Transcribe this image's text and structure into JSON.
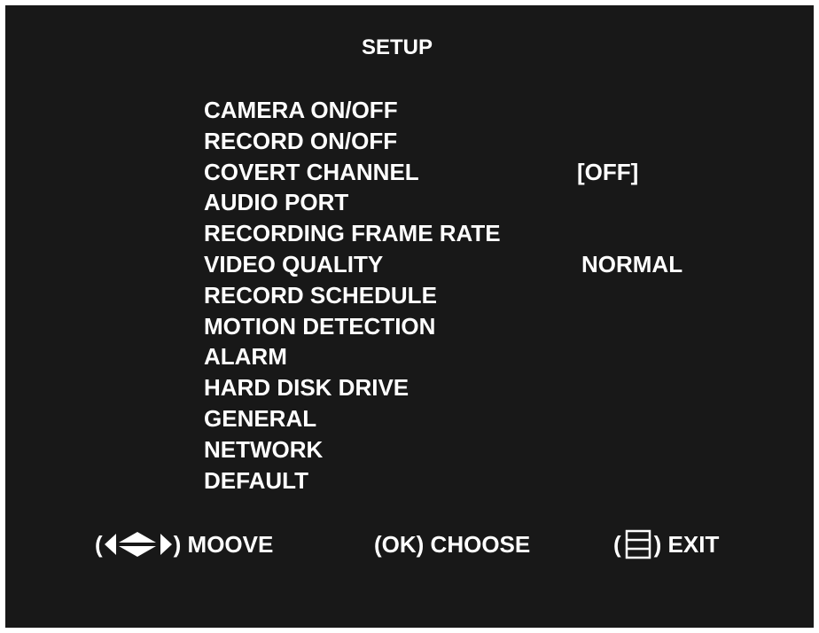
{
  "title": "SETUP",
  "menu": {
    "items": [
      {
        "label": "CAMERA ON/OFF",
        "value": ""
      },
      {
        "label": "RECORD ON/OFF",
        "value": ""
      },
      {
        "label": "COVERT CHANNEL",
        "value": "[OFF]"
      },
      {
        "label": "AUDIO PORT",
        "value": ""
      },
      {
        "label": "RECORDING FRAME RATE",
        "value": ""
      },
      {
        "label": "VIDEO QUALITY",
        "value": "NORMAL"
      },
      {
        "label": "RECORD SCHEDULE",
        "value": ""
      },
      {
        "label": "MOTION DETECTION",
        "value": ""
      },
      {
        "label": "ALARM",
        "value": ""
      },
      {
        "label": "HARD DISK DRIVE",
        "value": ""
      },
      {
        "label": "GENERAL",
        "value": ""
      },
      {
        "label": "NETWORK",
        "value": ""
      },
      {
        "label": "DEFAULT",
        "value": ""
      }
    ]
  },
  "footer": {
    "open_paren": "(",
    "close_paren_move": ") MOOVE",
    "choose": "(OK) CHOOSE",
    "exit_open": "(",
    "exit_close": ") EXIT",
    "move_icon": "arrow-keys-icon",
    "exit_icon": "menu-icon"
  },
  "colors": {
    "background": "#181818",
    "text": "#ffffff"
  }
}
